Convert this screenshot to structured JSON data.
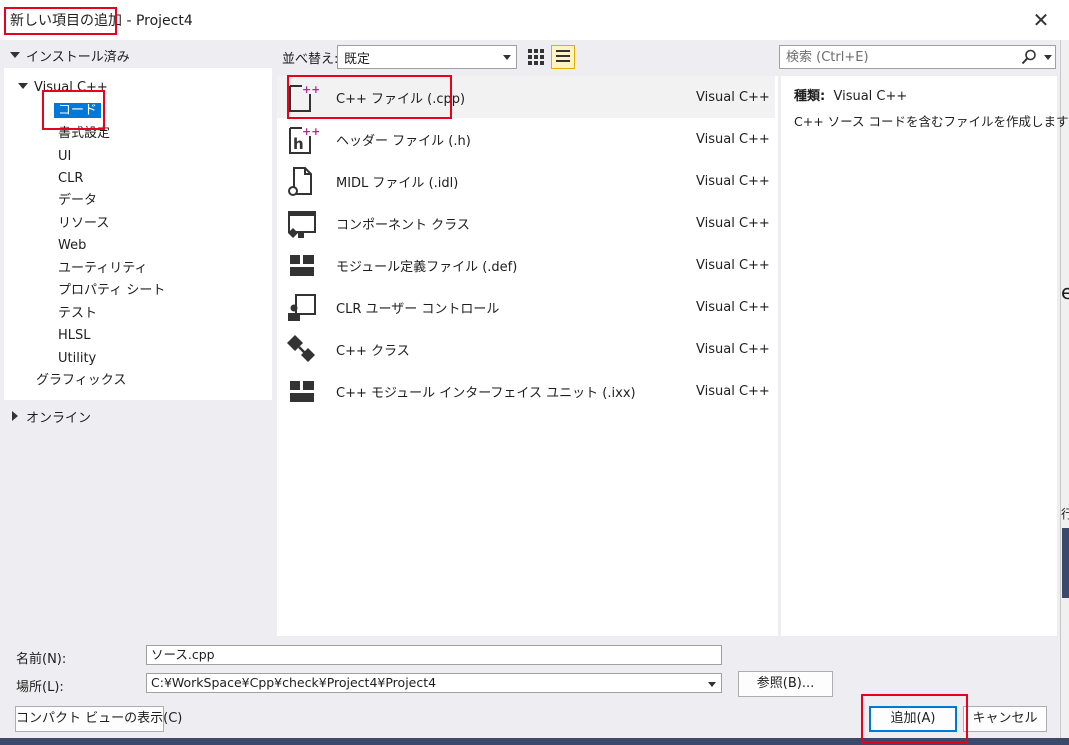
{
  "window": {
    "title": "新しい項目の追加 - Project4",
    "close_glyph": "✕",
    "peek_e": "e",
    "peek_k": "行"
  },
  "left": {
    "installed_label": "インストール済み",
    "tree": {
      "root": "Visual C++",
      "children": [
        "コード",
        "書式設定",
        "UI",
        "CLR",
        "データ",
        "リソース",
        "Web",
        "ユーティリティ",
        "プロパティ シート",
        "テスト",
        "HLSL",
        "Utility"
      ],
      "sibling": "グラフィックス"
    },
    "online_label": "オンライン"
  },
  "toolbar": {
    "sort_label": "並べ替え:",
    "sort_value": "既定"
  },
  "search": {
    "placeholder": "検索 (Ctrl+E)"
  },
  "templates": [
    {
      "name": "C++ ファイル (.cpp)",
      "type": "Visual C++",
      "icon": "cpp-file-icon"
    },
    {
      "name": "ヘッダー ファイル (.h)",
      "type": "Visual C++",
      "icon": "header-file-icon"
    },
    {
      "name": "MIDL ファイル (.idl)",
      "type": "Visual C++",
      "icon": "midl-file-icon"
    },
    {
      "name": "コンポーネント クラス",
      "type": "Visual C++",
      "icon": "component-class-icon"
    },
    {
      "name": "モジュール定義ファイル (.def)",
      "type": "Visual C++",
      "icon": "module-def-icon"
    },
    {
      "name": "CLR ユーザー コントロール",
      "type": "Visual C++",
      "icon": "clr-user-control-icon"
    },
    {
      "name": "C++ クラス",
      "type": "Visual C++",
      "icon": "cpp-class-icon"
    },
    {
      "name": "C++ モジュール インターフェイス ユニット (.ixx)",
      "type": "Visual C++",
      "icon": "module-interface-icon"
    }
  ],
  "details": {
    "type_label": "種類:",
    "type_value": "Visual C++",
    "description": "C++ ソース コードを含むファイルを作成します"
  },
  "form": {
    "name_label": "名前(N):",
    "name_value": "ソース.cpp",
    "location_label": "場所(L):",
    "location_value": "C:¥WorkSpace¥Cpp¥check¥Project4¥Project4",
    "browse_label": "参照(B)...",
    "compact_label": "コンパクト ビューの表示(C)",
    "add_label": "追加(A)",
    "cancel_label": "キャンセル"
  },
  "colors": {
    "accent": "#0078d7",
    "annotation": "#e8001c",
    "cpp_plus": "#b5279c"
  }
}
